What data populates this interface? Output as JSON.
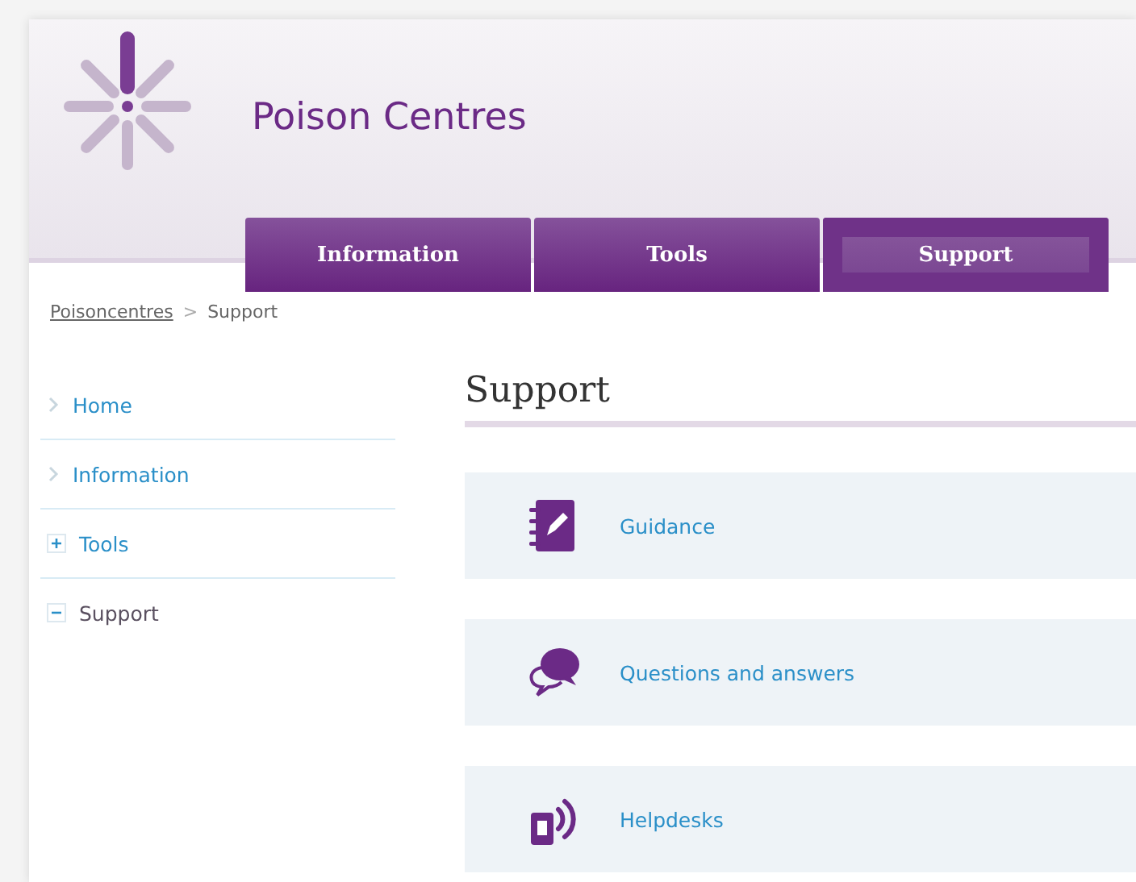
{
  "site": {
    "title": "Poison Centres"
  },
  "tabs": [
    {
      "label": "Information",
      "selected": false
    },
    {
      "label": "Tools",
      "selected": false
    },
    {
      "label": "Support",
      "selected": true
    }
  ],
  "breadcrumb": [
    {
      "label": "Poisoncentres",
      "kind": "link"
    },
    {
      "label": ">",
      "kind": "separator"
    },
    {
      "label": "Support",
      "kind": "current"
    }
  ],
  "sidebar": {
    "items": [
      {
        "label": "Home",
        "kind": "link",
        "selected": false
      },
      {
        "label": "Information",
        "kind": "link",
        "selected": false
      },
      {
        "label": "Tools",
        "kind": "toggle",
        "expanded": false,
        "selected": false
      },
      {
        "label": "Support",
        "kind": "toggle",
        "expanded": true,
        "selected": true
      }
    ]
  },
  "heading": "Support",
  "cards": [
    {
      "label": "Guidance",
      "kind": "notebook"
    },
    {
      "label": "Questions and answers",
      "kind": "chat"
    },
    {
      "label": "Helpdesks",
      "kind": "phone"
    }
  ]
}
